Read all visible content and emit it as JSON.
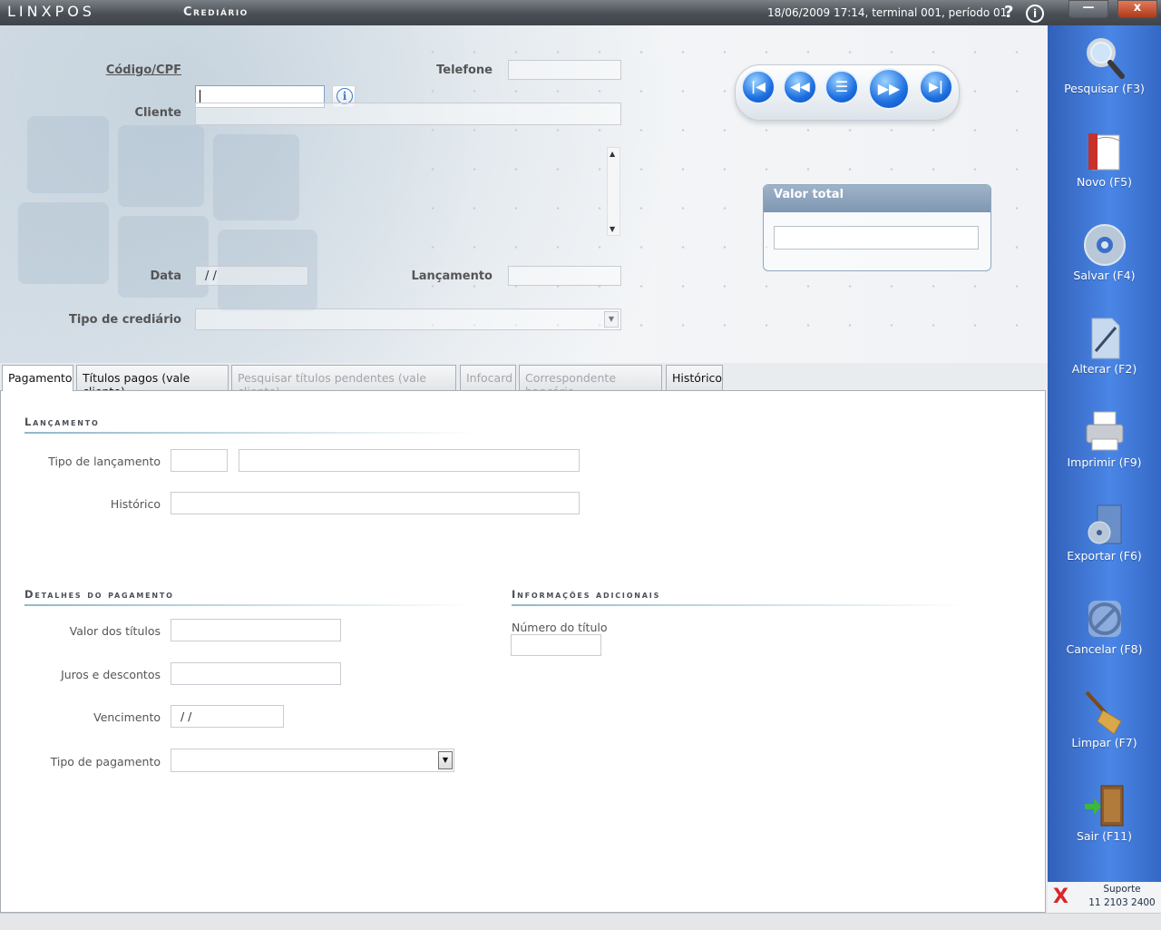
{
  "titlebar": {
    "logo": "LINXPOS",
    "title": "Crediário",
    "status": "18/06/2009 17:14, terminal 001, período 01.",
    "help_glyph": "?",
    "info_glyph": "i",
    "minimize_glyph": "—",
    "close_glyph": "x"
  },
  "header": {
    "codigo_label": "Código/CPF",
    "codigo_value": "",
    "telefone_label": "Telefone",
    "cliente_label": "Cliente",
    "data_label": "Data",
    "data_value": "/ /",
    "lancamento_label": "Lançamento",
    "tipo_crediario_label": "Tipo de crediário",
    "valor_total_label": "Valor total",
    "nav_icons": [
      "first-record-icon",
      "previous-record-icon",
      "list-icon",
      "next-record-icon",
      "last-record-icon"
    ]
  },
  "tabs": [
    {
      "label": "Pagamento",
      "state": "active"
    },
    {
      "label": "Títulos pagos (vale cliente)",
      "state": "enabled"
    },
    {
      "label": "Pesquisar títulos pendentes (vale cliente)",
      "state": "disabled"
    },
    {
      "label": "Infocard",
      "state": "disabled"
    },
    {
      "label": "Correspondente bancário",
      "state": "disabled"
    },
    {
      "label": "Histórico",
      "state": "enabled"
    }
  ],
  "pagamento": {
    "lancamento_section": "Lançamento",
    "tipo_lancamento_label": "Tipo de lançamento",
    "historico_label": "Histórico",
    "detalhes_section": "Detalhes do pagamento",
    "valor_titulos_label": "Valor dos títulos",
    "juros_label": "Juros e descontos",
    "vencimento_label": "Vencimento",
    "vencimento_value": "/ /",
    "tipo_pagamento_label": "Tipo de pagamento",
    "info_section": "Informações adicionais",
    "numero_titulo_label": "Número do título"
  },
  "sidebar": {
    "buttons": [
      {
        "label": "Pesquisar (F3)",
        "icon": "magnifier-icon"
      },
      {
        "label": "Novo (F5)",
        "icon": "new-document-icon"
      },
      {
        "label": "Salvar (F4)",
        "icon": "disc-icon"
      },
      {
        "label": "Alterar (F2)",
        "icon": "edit-document-icon"
      },
      {
        "label": "Imprimir (F9)",
        "icon": "printer-icon"
      },
      {
        "label": "Exportar (F6)",
        "icon": "export-icon"
      },
      {
        "label": "Cancelar (F8)",
        "icon": "cancel-icon"
      },
      {
        "label": "Limpar (F7)",
        "icon": "broom-icon"
      },
      {
        "label": "Sair (F11)",
        "icon": "exit-door-icon"
      }
    ]
  },
  "support": {
    "line1": "Suporte",
    "line2": "11 2103 2400",
    "logo": "X"
  },
  "colors": {
    "sidebar": "#3f77d6",
    "accent": "#1d6fe0",
    "title_bar": "#4a4f56"
  }
}
